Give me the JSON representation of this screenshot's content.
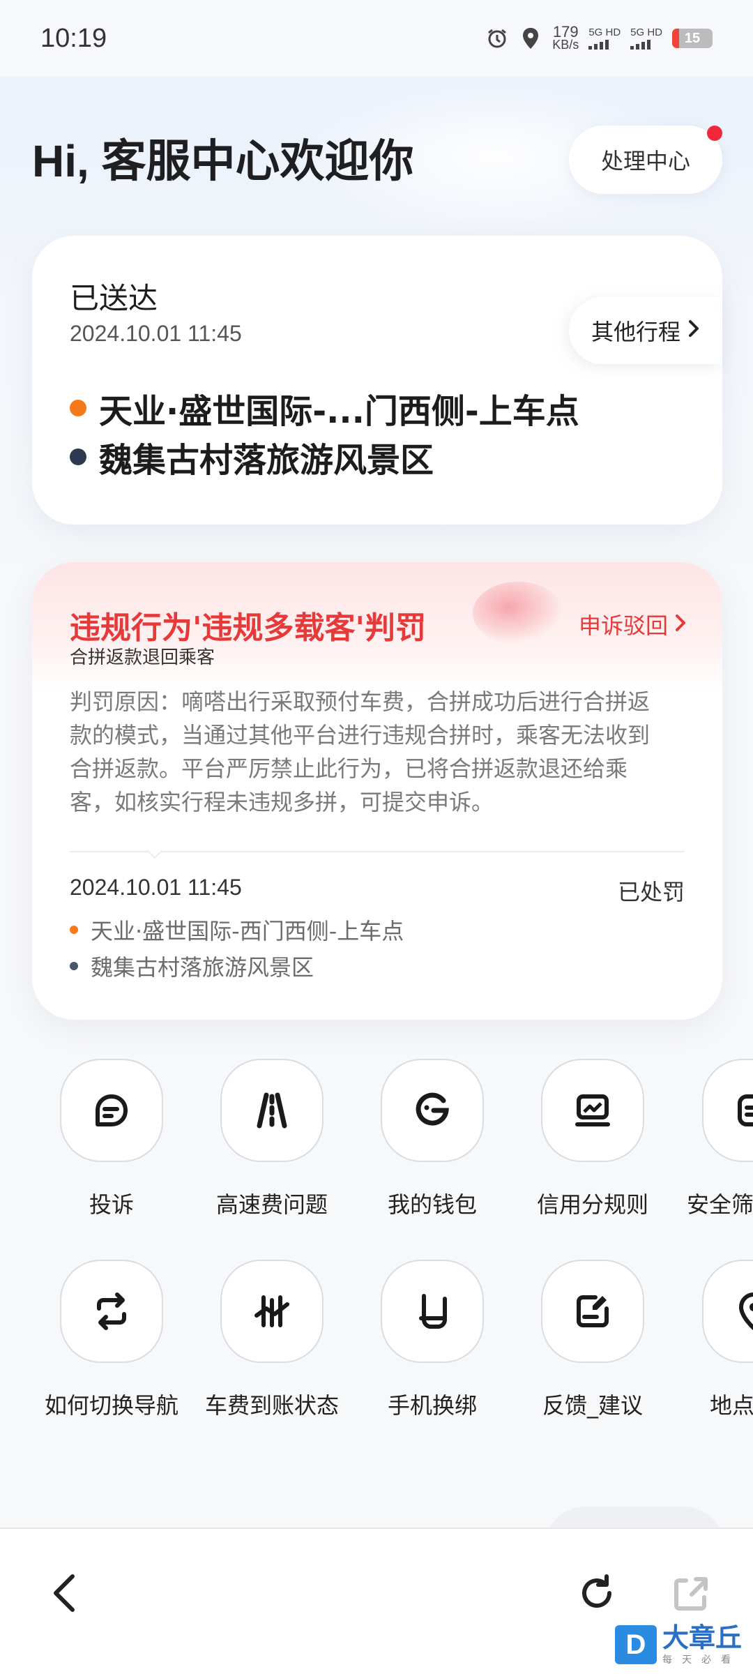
{
  "status_bar": {
    "time": "10:19",
    "speed_value": "179",
    "speed_unit": "KB/s",
    "sim1": "5G HD",
    "sim2": "5G HD",
    "battery": "15",
    "icons": [
      "alarm-icon",
      "location-icon"
    ]
  },
  "header": {
    "greeting": "Hi, 客服中心欢迎你",
    "process_center": "处理中心"
  },
  "trip": {
    "status": "已送达",
    "time": "2024.10.01 11:45",
    "other_trips": "其他行程",
    "start": "天业·盛世国际-...门西侧-上车点",
    "end": "魏集古村落旅游风景区"
  },
  "violation": {
    "title": "违规行为'违规多载客'判罚",
    "subtitle": "合拼返款退回乘客",
    "appeal": "申诉驳回",
    "reason_lines": [
      "判罚原因：嘀嗒出行采取预付车费，合拼成功后进行合拼返",
      "款的模式，当通过其他平台进行违规合拼时，乘客无法收到",
      "合拼返款。平台严厉禁止此行为，已将合拼返款退还给乘",
      "客，如核实行程未违规多拼，可提交申诉。"
    ],
    "time": "2024.10.01 11:45",
    "state": "已处罚",
    "start": "天业·盛世国际-西门西侧-上车点",
    "end": "魏集古村落旅游风景区"
  },
  "quick_actions": {
    "row1": [
      {
        "label": "投诉",
        "icon": "chat-complaint-icon"
      },
      {
        "label": "高速费问题",
        "icon": "highway-icon"
      },
      {
        "label": "我的钱包",
        "icon": "wallet-icon"
      },
      {
        "label": "信用分规则",
        "icon": "credit-score-icon"
      },
      {
        "label": "安全筛",
        "icon": "safety-icon"
      }
    ],
    "row2": [
      {
        "label": "如何切换导航",
        "icon": "switch-navigation-icon"
      },
      {
        "label": "车费到账状态",
        "icon": "fare-status-icon"
      },
      {
        "label": "手机换绑",
        "icon": "phone-rebind-icon"
      },
      {
        "label": "反馈_建议",
        "icon": "feedback-icon"
      },
      {
        "label": "地点",
        "icon": "place-icon"
      }
    ]
  },
  "bottom_bar": {
    "icons": [
      "back-icon",
      "refresh-icon",
      "share-icon"
    ]
  },
  "watermark": {
    "logo_letter": "D",
    "brand": "大章丘",
    "tagline": "每天必看"
  }
}
